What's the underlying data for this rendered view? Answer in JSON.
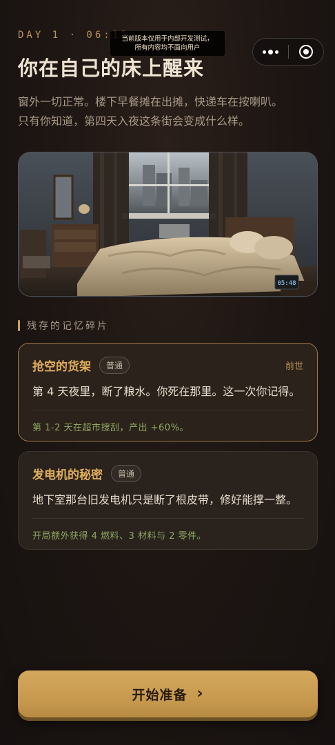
{
  "header": {
    "day_label": "DAY 1 · 06:12",
    "dev_notice_line1": "当前版本仅用于内部开发测试，",
    "dev_notice_line2": "所有内容均不面向用户"
  },
  "capsule": {
    "more_icon": "more-dots-icon",
    "close_icon": "record-circle-icon"
  },
  "title": "你在自己的床上醒来",
  "intro": {
    "line1": "窗外一切正常。楼下早餐摊在出摊，快递车在按喇叭。",
    "line2": "只有你知道，第四天入夜这条街会变成什么样。"
  },
  "scene": {
    "clock_text": "05:48"
  },
  "section_title": "残存的记忆碎片",
  "memories": [
    {
      "name": "抢空的货架",
      "tag": "普通",
      "meta": "前世",
      "desc": "第 4 天夜里，断了粮水。你死在那里。这一次你记得。",
      "effect": "第 1-2 天在超市搜刮，产出 +60%。"
    },
    {
      "name": "发电机的秘密",
      "tag": "普通",
      "desc": "地下室那台旧发电机只是断了根皮带，修好能撑一整。",
      "effect": "开局额外获得 4 燃料、3 材料与 2 零件。"
    }
  ],
  "start_button": {
    "label": "开始准备",
    "icon": "chevron-right-icon"
  },
  "colors": {
    "accent": "#c9a25e",
    "effect_green": "#8ea861",
    "card_title": "#e0ae5c"
  }
}
